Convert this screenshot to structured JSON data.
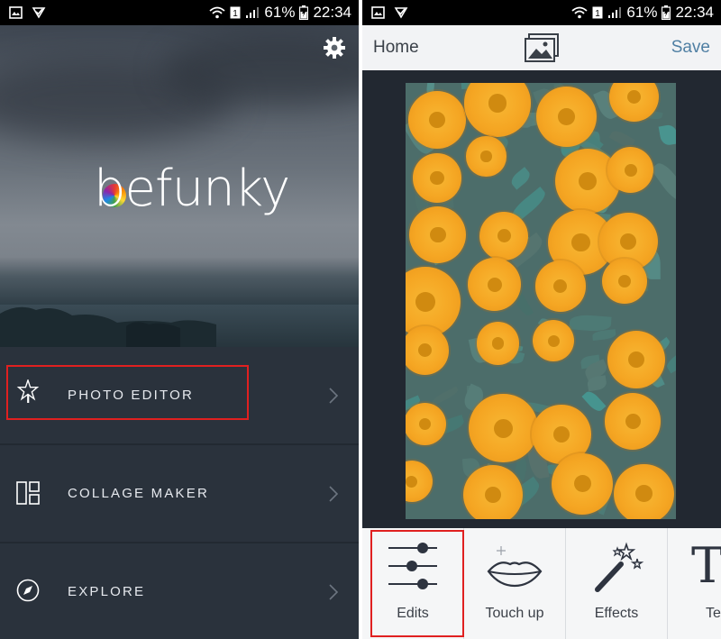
{
  "status_bar": {
    "battery_percent": "61%",
    "time": "22:34"
  },
  "left": {
    "logo_text": "befunky",
    "menu": [
      {
        "label": "PHOTO EDITOR",
        "icon": "star-wand-icon"
      },
      {
        "label": "COLLAGE MAKER",
        "icon": "collage-grid-icon"
      },
      {
        "label": "EXPLORE",
        "icon": "compass-icon"
      }
    ]
  },
  "right": {
    "header": {
      "home_label": "Home",
      "save_label": "Save",
      "gallery_icon": "gallery-icon"
    },
    "tools": [
      {
        "label": "Edits",
        "icon": "sliders-icon"
      },
      {
        "label": "Touch up",
        "icon": "lips-icon"
      },
      {
        "label": "Effects",
        "icon": "magic-wand-icon"
      },
      {
        "label": "Te",
        "icon": "text-icon"
      }
    ]
  },
  "colors": {
    "highlight": "#e02020",
    "save_accent": "#4f7fa3",
    "menu_background": "#2a323c"
  }
}
